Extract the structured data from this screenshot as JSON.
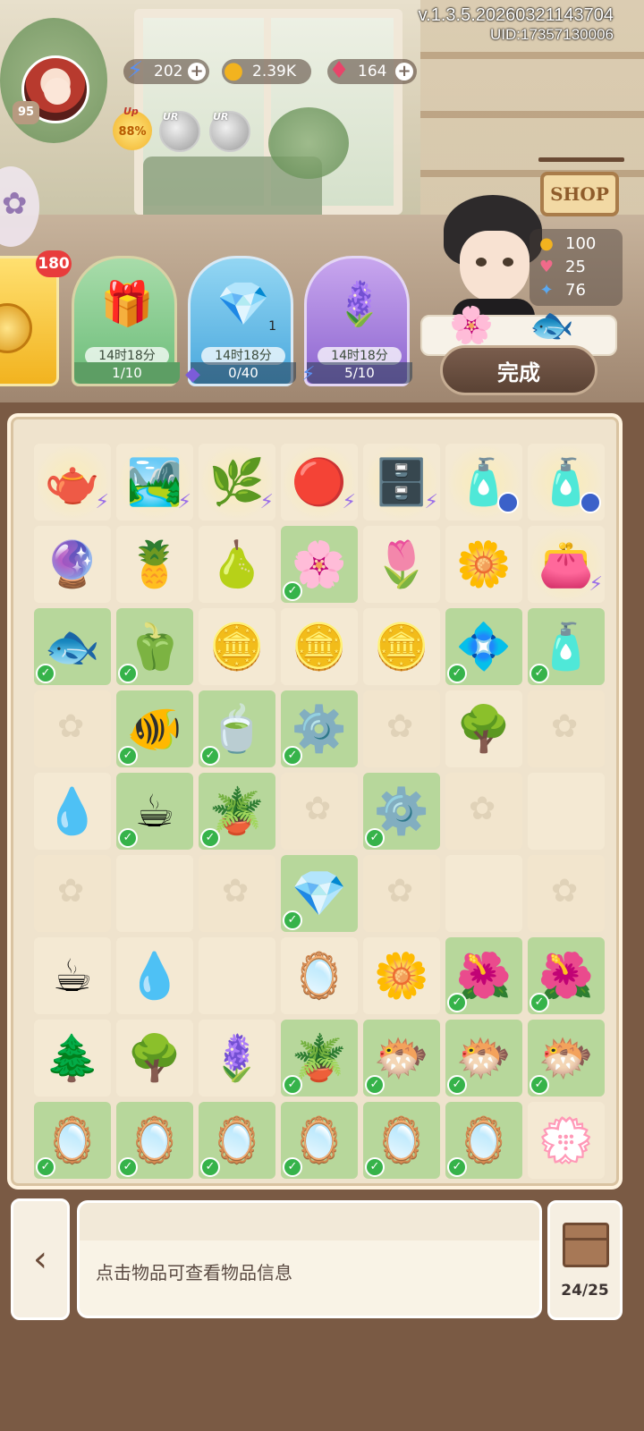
{
  "header": {
    "version": "v.1.3.5.20260321143704",
    "uid": "UID:17357130006",
    "player_level": "95"
  },
  "resources": [
    {
      "name": "energy",
      "icon": "lightning-icon",
      "value": "202"
    },
    {
      "name": "coins",
      "icon": "clover-coin-icon",
      "value": "2.39K"
    },
    {
      "name": "gems",
      "icon": "gem-icon",
      "value": "164"
    }
  ],
  "boosts": {
    "up_label": "Up",
    "up_percent": "88%",
    "ur_label": "UR"
  },
  "orders": {
    "badge_count": "180",
    "cards": [
      {
        "theme": "green",
        "icon": "🎁",
        "timer": "14时18分",
        "progress": "1/10",
        "qty": ""
      },
      {
        "theme": "blue",
        "icon": "💎",
        "timer": "14时18分",
        "progress": "0/40",
        "qty": "1"
      },
      {
        "theme": "purple",
        "icon": "🪻",
        "timer": "14时18分",
        "progress": "5/10",
        "qty": ""
      }
    ]
  },
  "customer": {
    "shop_sign": "SHOP",
    "rewards": [
      {
        "icon": "coin-icon",
        "value": "100"
      },
      {
        "icon": "heart-icon",
        "value": "25"
      },
      {
        "icon": "butterfly-icon",
        "value": "76"
      }
    ],
    "done_label": "完成"
  },
  "board": {
    "rows": [
      [
        {
          "s": "empty",
          "i": "🫖",
          "g": "bolt"
        },
        {
          "s": "empty",
          "i": "🏞️",
          "g": "bolt"
        },
        {
          "s": "empty",
          "i": "🌿",
          "g": "bolt"
        },
        {
          "s": "empty",
          "i": "🔴",
          "g": "bolt"
        },
        {
          "s": "empty",
          "i": "🗄️",
          "g": "bolt"
        },
        {
          "s": "empty",
          "i": "🧴",
          "g": "clock"
        },
        {
          "s": "empty",
          "i": "🧴",
          "g": "clock"
        }
      ],
      [
        {
          "s": "empty",
          "i": "🔮"
        },
        {
          "s": "empty",
          "i": "🍍"
        },
        {
          "s": "empty",
          "i": "🍐"
        },
        {
          "s": "ok",
          "i": "🌸",
          "c": true
        },
        {
          "s": "empty",
          "i": "🌷"
        },
        {
          "s": "empty",
          "i": "🌼"
        },
        {
          "s": "empty",
          "i": "👛",
          "g": "bolt"
        }
      ],
      [
        {
          "s": "ok",
          "i": "🐟",
          "c": true
        },
        {
          "s": "ok",
          "i": "🫑",
          "c": true
        },
        {
          "s": "empty",
          "i": "🪙"
        },
        {
          "s": "empty",
          "i": "🪙"
        },
        {
          "s": "empty",
          "i": "🪙"
        },
        {
          "s": "ok",
          "i": "💠",
          "c": true
        },
        {
          "s": "ok",
          "i": "🧴",
          "c": true
        }
      ],
      [
        {
          "s": "locked"
        },
        {
          "s": "ok",
          "i": "🐠",
          "c": true
        },
        {
          "s": "ok",
          "i": "🍵",
          "c": true
        },
        {
          "s": "ok",
          "i": "⚙️",
          "c": true
        },
        {
          "s": "locked"
        },
        {
          "s": "empty",
          "i": "🌳"
        },
        {
          "s": "locked"
        }
      ],
      [
        {
          "s": "empty",
          "i": "💧"
        },
        {
          "s": "ok",
          "i": "☕",
          "c": true
        },
        {
          "s": "ok",
          "i": "🪴",
          "c": true
        },
        {
          "s": "locked"
        },
        {
          "s": "ok",
          "i": "⚙️",
          "c": true
        },
        {
          "s": "locked"
        },
        {
          "s": "empty"
        }
      ],
      [
        {
          "s": "locked"
        },
        {
          "s": "empty"
        },
        {
          "s": "locked"
        },
        {
          "s": "ok",
          "i": "💎",
          "c": true
        },
        {
          "s": "locked"
        },
        {
          "s": "empty"
        },
        {
          "s": "locked"
        }
      ],
      [
        {
          "s": "empty",
          "i": "☕"
        },
        {
          "s": "empty",
          "i": "💧"
        },
        {
          "s": "empty"
        },
        {
          "s": "empty",
          "i": "🪞"
        },
        {
          "s": "empty",
          "i": "🌼"
        },
        {
          "s": "ok",
          "i": "🌺",
          "c": true
        },
        {
          "s": "ok",
          "i": "🌺",
          "c": true
        }
      ],
      [
        {
          "s": "empty",
          "i": "🌲"
        },
        {
          "s": "empty",
          "i": "🌳"
        },
        {
          "s": "empty",
          "i": "🪻"
        },
        {
          "s": "ok",
          "i": "🪴",
          "c": true
        },
        {
          "s": "ok",
          "i": "🐡",
          "c": true
        },
        {
          "s": "ok",
          "i": "🐡",
          "c": true
        },
        {
          "s": "ok",
          "i": "🐡",
          "c": true
        }
      ],
      [
        {
          "s": "ok",
          "i": "🪞",
          "c": true
        },
        {
          "s": "ok",
          "i": "🪞",
          "c": true
        },
        {
          "s": "ok",
          "i": "🪞",
          "c": true
        },
        {
          "s": "ok",
          "i": "🪞",
          "c": true
        },
        {
          "s": "ok",
          "i": "🪞",
          "c": true
        },
        {
          "s": "ok",
          "i": "🪞",
          "c": true
        },
        {
          "s": "empty",
          "i": "💮"
        }
      ]
    ]
  },
  "bottom": {
    "hint": "点击物品可查看物品信息",
    "bag_count": "24/25"
  }
}
